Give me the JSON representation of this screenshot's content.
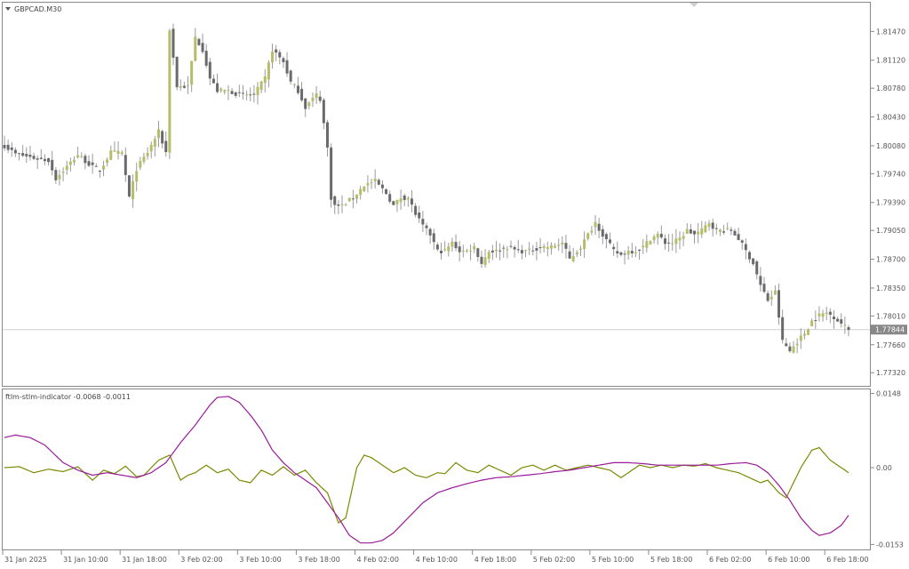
{
  "symbol_title": "GBPCAD.M30",
  "current_price_label": "1.77844",
  "colors": {
    "background": "#ffffff",
    "grid_border": "#888888",
    "bull": "#b5bd68",
    "bear": "#6a6a6e",
    "wick": "#9a9a9a",
    "bid_line": "#cfcfcf",
    "price_tag_bg": "#888888",
    "ftlm": "#7a8a00",
    "stlm": "#9a1a9a"
  },
  "chart_data": [
    {
      "type": "candlestick",
      "title": "GBPCAD.M30",
      "ylim": [
        1.7716,
        1.8182
      ],
      "y_ticks": [
        "1.81470",
        "1.81120",
        "1.80780",
        "1.80430",
        "1.80080",
        "1.79740",
        "1.79390",
        "1.79050",
        "1.78700",
        "1.78350",
        "1.78010",
        "1.77660",
        "1.77320"
      ],
      "y_tick_values": [
        1.8147,
        1.8112,
        1.8078,
        1.8043,
        1.8008,
        1.7974,
        1.7939,
        1.7905,
        1.787,
        1.7835,
        1.7801,
        1.7766,
        1.7732
      ],
      "current_price": 1.77844,
      "current_price_label": "1.77844",
      "x_tick_labels": [
        "31 Jan 2025",
        "31 Jan 10:00",
        "31 Jan 18:00",
        "3 Feb 02:00",
        "3 Feb 10:00",
        "3 Feb 18:00",
        "4 Feb 02:00",
        "4 Feb 10:00",
        "4 Feb 18:00",
        "5 Feb 02:00",
        "5 Feb 10:00",
        "5 Feb 18:00",
        "6 Feb 02:00",
        "6 Feb 10:00",
        "6 Feb 18:00"
      ],
      "close_anchors": [
        [
          0,
          1.8008
        ],
        [
          3,
          1.7998
        ],
        [
          8,
          1.7993
        ],
        [
          12,
          1.799
        ],
        [
          14,
          1.7968
        ],
        [
          16,
          1.7978
        ],
        [
          20,
          1.7997
        ],
        [
          24,
          1.7982
        ],
        [
          26,
          1.7978
        ],
        [
          29,
          1.8
        ],
        [
          32,
          1.7999
        ],
        [
          34,
          1.7945
        ],
        [
          36,
          1.798
        ],
        [
          39,
          1.8
        ],
        [
          42,
          1.8025
        ],
        [
          44,
          1.8
        ],
        [
          45,
          1.815
        ],
        [
          47,
          1.808
        ],
        [
          50,
          1.808
        ],
        [
          52,
          1.814
        ],
        [
          54,
          1.8125
        ],
        [
          56,
          1.809
        ],
        [
          58,
          1.8075
        ],
        [
          61,
          1.8075
        ],
        [
          64,
          1.807
        ],
        [
          66,
          1.807
        ],
        [
          68,
          1.807
        ],
        [
          71,
          1.809
        ],
        [
          73,
          1.8125
        ],
        [
          76,
          1.811
        ],
        [
          78,
          1.8085
        ],
        [
          80,
          1.8075
        ],
        [
          82,
          1.8055
        ],
        [
          85,
          1.807
        ],
        [
          86,
          1.8065
        ],
        [
          88,
          1.8005
        ],
        [
          89,
          1.7945
        ],
        [
          90,
          1.7935
        ],
        [
          92,
          1.7935
        ],
        [
          95,
          1.7945
        ],
        [
          98,
          1.796
        ],
        [
          101,
          1.7965
        ],
        [
          104,
          1.795
        ],
        [
          106,
          1.7935
        ],
        [
          108,
          1.7945
        ],
        [
          110,
          1.7945
        ],
        [
          112,
          1.7925
        ],
        [
          114,
          1.791
        ],
        [
          116,
          1.79
        ],
        [
          118,
          1.788
        ],
        [
          120,
          1.788
        ],
        [
          122,
          1.789
        ],
        [
          124,
          1.788
        ],
        [
          126,
          1.788
        ],
        [
          128,
          1.7885
        ],
        [
          130,
          1.7865
        ],
        [
          132,
          1.788
        ],
        [
          134,
          1.788
        ],
        [
          137,
          1.7885
        ],
        [
          140,
          1.788
        ],
        [
          143,
          1.788
        ],
        [
          146,
          1.7885
        ],
        [
          149,
          1.7885
        ],
        [
          152,
          1.789
        ],
        [
          154,
          1.787
        ],
        [
          157,
          1.7885
        ],
        [
          159,
          1.79
        ],
        [
          161,
          1.7915
        ],
        [
          163,
          1.79
        ],
        [
          166,
          1.788
        ],
        [
          168,
          1.7875
        ],
        [
          170,
          1.788
        ],
        [
          172,
          1.788
        ],
        [
          174,
          1.7885
        ],
        [
          176,
          1.7895
        ],
        [
          178,
          1.79
        ],
        [
          180,
          1.789
        ],
        [
          182,
          1.789
        ],
        [
          184,
          1.7895
        ],
        [
          186,
          1.7905
        ],
        [
          188,
          1.79
        ],
        [
          190,
          1.7905
        ],
        [
          192,
          1.7915
        ],
        [
          194,
          1.7905
        ],
        [
          196,
          1.7905
        ],
        [
          198,
          1.7905
        ],
        [
          200,
          1.7895
        ],
        [
          202,
          1.788
        ],
        [
          204,
          1.7865
        ],
        [
          206,
          1.7838
        ],
        [
          208,
          1.782
        ],
        [
          210,
          1.783
        ],
        [
          212,
          1.777
        ],
        [
          214,
          1.7758
        ],
        [
          216,
          1.777
        ],
        [
          218,
          1.778
        ],
        [
          220,
          1.7795
        ],
        [
          222,
          1.7802
        ],
        [
          224,
          1.7805
        ],
        [
          226,
          1.78
        ],
        [
          228,
          1.7792
        ],
        [
          230,
          1.77844
        ]
      ]
    },
    {
      "type": "line",
      "title": "ftlm-stlm-indicator -0.0068 -0.0011",
      "ylim": [
        -0.0163,
        0.0156
      ],
      "y_ticks": [
        "0.0148",
        "0.00",
        "-0.0153"
      ],
      "y_tick_values": [
        0.0148,
        0.0,
        -0.0153
      ],
      "series": [
        {
          "name": "ftlm",
          "color": "#7a8a00",
          "anchors": [
            [
              0,
              0.0
            ],
            [
              4,
              0.0002
            ],
            [
              8,
              -0.001
            ],
            [
              12,
              -0.0003
            ],
            [
              16,
              -0.0008
            ],
            [
              20,
              0.0002
            ],
            [
              24,
              -0.0025
            ],
            [
              27,
              -0.0005
            ],
            [
              30,
              -0.0012
            ],
            [
              33,
              0.0003
            ],
            [
              36,
              -0.0018
            ],
            [
              38,
              -0.0015
            ],
            [
              42,
              0.0015
            ],
            [
              45,
              0.0025
            ],
            [
              48,
              -0.0025
            ],
            [
              50,
              -0.0015
            ],
            [
              52,
              -0.001
            ],
            [
              55,
              0.0005
            ],
            [
              58,
              -0.001
            ],
            [
              61,
              -0.0003
            ],
            [
              64,
              -0.0025
            ],
            [
              67,
              -0.003
            ],
            [
              70,
              -0.0005
            ],
            [
              73,
              -0.0015
            ],
            [
              76,
              0.0002
            ],
            [
              79,
              -0.0015
            ],
            [
              82,
              -0.0005
            ],
            [
              85,
              -0.003
            ],
            [
              88,
              -0.005
            ],
            [
              91,
              -0.011
            ],
            [
              93,
              -0.01
            ],
            [
              96,
              0.0
            ],
            [
              98,
              0.0025
            ],
            [
              100,
              0.002
            ],
            [
              103,
              0.0005
            ],
            [
              106,
              -0.001
            ],
            [
              109,
              0.0
            ],
            [
              112,
              -0.0015
            ],
            [
              115,
              -0.002
            ],
            [
              118,
              -0.001
            ],
            [
              120,
              -0.0012
            ],
            [
              123,
              0.001
            ],
            [
              126,
              -0.0005
            ],
            [
              129,
              -0.001
            ],
            [
              132,
              0.0005
            ],
            [
              135,
              -0.0005
            ],
            [
              138,
              -0.0015
            ],
            [
              141,
              0.0
            ],
            [
              144,
              0.0005
            ],
            [
              147,
              -0.0005
            ],
            [
              150,
              0.0005
            ],
            [
              153,
              -0.0005
            ],
            [
              156,
              0.0
            ],
            [
              159,
              0.0005
            ],
            [
              162,
              0.0
            ],
            [
              165,
              -0.0005
            ],
            [
              168,
              -0.002
            ],
            [
              170,
              -0.001
            ],
            [
              173,
              0.0005
            ],
            [
              176,
              0.0
            ],
            [
              179,
              0.0005
            ],
            [
              182,
              0.0
            ],
            [
              185,
              0.0005
            ],
            [
              188,
              0.0003
            ],
            [
              191,
              0.0008
            ],
            [
              194,
              0.0
            ],
            [
              197,
              -0.0005
            ],
            [
              200,
              -0.001
            ],
            [
              203,
              -0.002
            ],
            [
              206,
              -0.003
            ],
            [
              208,
              -0.0025
            ],
            [
              211,
              -0.005
            ],
            [
              213,
              -0.006
            ],
            [
              215,
              -0.003
            ],
            [
              217,
              0.0
            ],
            [
              220,
              0.0035
            ],
            [
              222,
              0.004
            ],
            [
              225,
              0.0015
            ],
            [
              228,
              0.0
            ],
            [
              230,
              -0.001
            ]
          ]
        },
        {
          "name": "stlm",
          "color": "#9a1a9a",
          "anchors": [
            [
              0,
              0.006
            ],
            [
              3,
              0.0065
            ],
            [
              7,
              0.006
            ],
            [
              11,
              0.0045
            ],
            [
              16,
              0.001
            ],
            [
              20,
              -0.0005
            ],
            [
              24,
              -0.0015
            ],
            [
              28,
              -0.001
            ],
            [
              32,
              -0.0015
            ],
            [
              36,
              -0.002
            ],
            [
              40,
              -0.001
            ],
            [
              44,
              0.001
            ],
            [
              48,
              0.005
            ],
            [
              52,
              0.0085
            ],
            [
              56,
              0.0125
            ],
            [
              58,
              0.014
            ],
            [
              61,
              0.0142
            ],
            [
              64,
              0.013
            ],
            [
              67,
              0.0105
            ],
            [
              70,
              0.0075
            ],
            [
              73,
              0.0035
            ],
            [
              76,
              0.001
            ],
            [
              79,
              -0.001
            ],
            [
              82,
              -0.0025
            ],
            [
              85,
              -0.004
            ],
            [
              88,
              -0.007
            ],
            [
              91,
              -0.01
            ],
            [
              94,
              -0.0135
            ],
            [
              97,
              -0.015
            ],
            [
              100,
              -0.015
            ],
            [
              103,
              -0.0145
            ],
            [
              106,
              -0.013
            ],
            [
              110,
              -0.01
            ],
            [
              114,
              -0.007
            ],
            [
              118,
              -0.005
            ],
            [
              122,
              -0.004
            ],
            [
              126,
              -0.0032
            ],
            [
              130,
              -0.0025
            ],
            [
              134,
              -0.002
            ],
            [
              138,
              -0.0018
            ],
            [
              142,
              -0.0015
            ],
            [
              146,
              -0.0012
            ],
            [
              150,
              -0.0008
            ],
            [
              154,
              -0.0005
            ],
            [
              158,
              0.0
            ],
            [
              162,
              0.0005
            ],
            [
              166,
              0.001
            ],
            [
              170,
              0.001
            ],
            [
              174,
              0.0008
            ],
            [
              178,
              0.0005
            ],
            [
              182,
              0.0005
            ],
            [
              186,
              0.0005
            ],
            [
              190,
              0.0005
            ],
            [
              194,
              0.0005
            ],
            [
              198,
              0.0008
            ],
            [
              202,
              0.001
            ],
            [
              205,
              0.0005
            ],
            [
              208,
              -0.001
            ],
            [
              211,
              -0.0035
            ],
            [
              214,
              -0.0065
            ],
            [
              217,
              -0.01
            ],
            [
              220,
              -0.0125
            ],
            [
              222,
              -0.0135
            ],
            [
              225,
              -0.013
            ],
            [
              228,
              -0.0115
            ],
            [
              230,
              -0.0095
            ]
          ]
        }
      ]
    }
  ]
}
